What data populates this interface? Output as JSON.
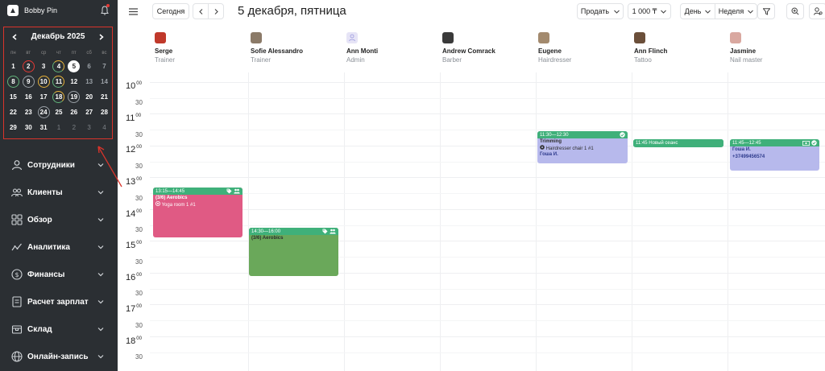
{
  "brand": {
    "name": "Bobby Pin"
  },
  "mini_calendar": {
    "title": "Декабрь 2025",
    "weekdays": [
      "пн",
      "вт",
      "ср",
      "чт",
      "пт",
      "сб",
      "вс"
    ],
    "weeks": [
      [
        "1",
        "2",
        "3",
        "4",
        "5",
        "6",
        "7"
      ],
      [
        "8",
        "9",
        "10",
        "11",
        "12",
        "13",
        "14"
      ],
      [
        "15",
        "16",
        "17",
        "18",
        "19",
        "20",
        "21"
      ],
      [
        "22",
        "23",
        "24",
        "25",
        "26",
        "27",
        "28"
      ],
      [
        "29",
        "30",
        "31",
        "1",
        "2",
        "3",
        "4"
      ]
    ]
  },
  "menu": {
    "items": [
      {
        "label": "Сотрудники"
      },
      {
        "label": "Клиенты"
      },
      {
        "label": "Обзор"
      },
      {
        "label": "Аналитика"
      },
      {
        "label": "Финансы"
      },
      {
        "label": "Расчет зарплат"
      },
      {
        "label": "Склад"
      },
      {
        "label": "Онлайн-запись"
      }
    ]
  },
  "toolbar": {
    "today": "Сегодня",
    "date": "5 декабря, пятница",
    "sell": "Продать",
    "amount": "1 000 ₸",
    "day": "День",
    "week": "Неделя"
  },
  "staff": [
    {
      "name": "Serge",
      "role": "Trainer"
    },
    {
      "name": "Sofie Alessandro",
      "role": "Trainer"
    },
    {
      "name": "Ann Monti",
      "role": "Admin"
    },
    {
      "name": "Andrew Comrack",
      "role": "Barber"
    },
    {
      "name": "Eugene",
      "role": "Hairdresser"
    },
    {
      "name": "Ann Flinch",
      "role": "Tattoo"
    },
    {
      "name": "Jasmine",
      "role": "Nail master"
    }
  ],
  "timeline": {
    "hours": [
      "10",
      "11",
      "12",
      "13",
      "14",
      "15",
      "16",
      "17",
      "18"
    ],
    "minutes_full": "00",
    "minutes_half": "30"
  },
  "events": [
    {
      "time": "13:15—14:45",
      "title": "(3/6) Aerobics",
      "detail": "Yoga room 1 #1",
      "color": "#e05a84",
      "head": "#3fb07a"
    },
    {
      "time": "14:30—16:00",
      "title": "(3/6) Aerobics",
      "color": "#6aa85a",
      "head": "#3fb07a"
    },
    {
      "time": "11:30—12:30",
      "title": "Trimming",
      "detail": "Hairdresser chair 1 #1",
      "client": "Гоша И.",
      "color": "#b7b9ec",
      "head": "#3fb07a"
    },
    {
      "time": "11:45 Новый сеанс",
      "color": "#3fb07a"
    },
    {
      "time": "11:45—12:45",
      "client": "Гоша И.",
      "phone": "+37499456574",
      "color": "#b7b9ec",
      "head": "#3fb07a"
    }
  ]
}
